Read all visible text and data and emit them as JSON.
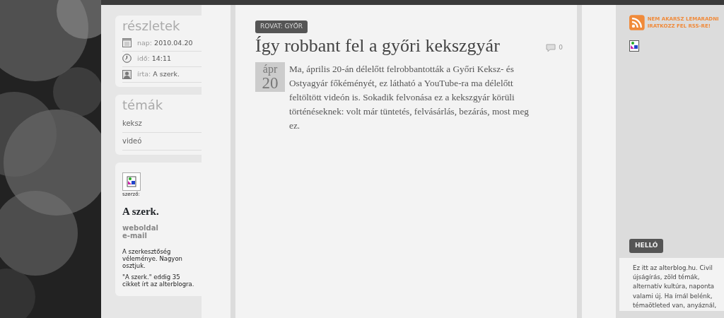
{
  "details": {
    "title": "részletek",
    "rows": [
      {
        "kind": "calendar",
        "label": "nap:",
        "value": "2010.04.20"
      },
      {
        "kind": "clock",
        "label": "idő:",
        "value": "14:11"
      },
      {
        "kind": "author",
        "label": "írta:",
        "value": "A szerk."
      }
    ]
  },
  "topics": {
    "title": "témák",
    "items": [
      "keksz",
      "videó"
    ]
  },
  "author_box": {
    "caption": "szerző:",
    "name": "A szerk.",
    "links": [
      "weboldal",
      "e-mail"
    ],
    "bio": "A szerkesztőség véleménye. Nagyon osztjuk.",
    "count": "\"A szerk.\" eddig 35 cikket írt az alterblogra."
  },
  "article": {
    "category": "ROVAT: GYŐR",
    "title": "Így robbant fel a győri kekszgyár",
    "comments": "0",
    "date_month": "ápr",
    "date_day": "20",
    "body": "Ma, április 20-án délelőtt felrobbantották a Győri Keksz- és Ostyagyár főkéményét, ez látható a YouTube-ra ma délelőtt feltöltött videón is. Sokadik felvonása ez a kekszgyár körüli történéseknek: volt már tüntetés, felvásárlás, bezárás, most meg ez."
  },
  "rss": {
    "text": "NEM AKARSZ LEMARADNI IRATKOZZ FEL RSS-RE!"
  },
  "hello": {
    "label": "HELLÓ",
    "text": "Ez itt az alterblog.hu. Civil újságírás, zöld témák, alternatív kultúra, naponta valami új. Ha írnál belénk, témaötleted van, anyáznál,"
  }
}
